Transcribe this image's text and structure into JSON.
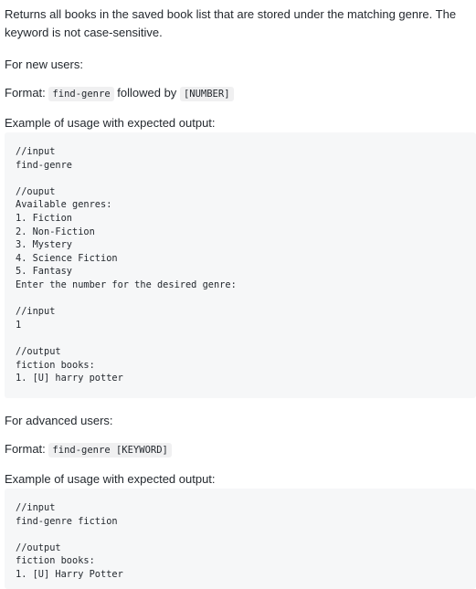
{
  "intro": "Returns all books in the saved book list that are stored under the matching genre. The keyword is not case-sensitive.",
  "new_users": {
    "heading": "For new users:",
    "format_label": "Format:",
    "format_command": "find-genre",
    "format_middle": "followed by",
    "format_arg": "[NUMBER]",
    "example_label": "Example of usage with expected output:",
    "code_lines": [
      "//input",
      "find-genre",
      "",
      "//ouput",
      "Available genres:",
      "1. Fiction",
      "2. Non-Fiction",
      "3. Mystery",
      "4. Science Fiction",
      "5. Fantasy",
      "Enter the number for the desired genre:",
      "",
      "//input",
      "1",
      "",
      "//output",
      "fiction books:",
      "1. [U] harry potter"
    ]
  },
  "advanced_users": {
    "heading": "For advanced users:",
    "format_label": "Format:",
    "format_command": "find-genre [KEYWORD]",
    "example_label": "Example of usage with expected output:",
    "code_lines": [
      "//input",
      "find-genre fiction",
      "",
      "//output",
      "fiction books:",
      "1. [U] Harry Potter"
    ]
  }
}
